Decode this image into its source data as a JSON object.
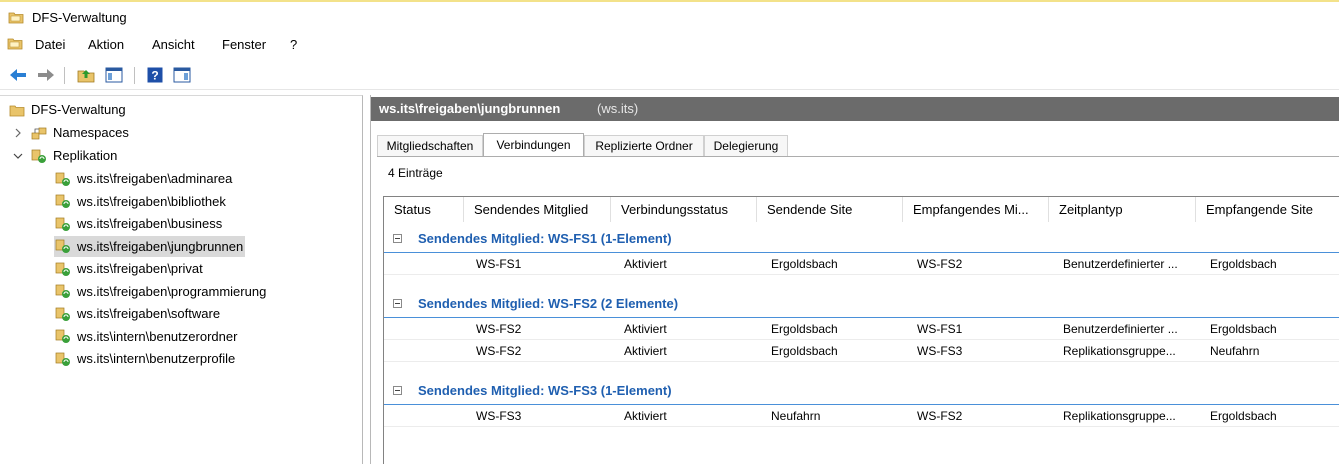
{
  "window": {
    "title": "DFS-Verwaltung"
  },
  "menu": {
    "items": [
      "Datei",
      "Aktion",
      "Ansicht",
      "Fenster",
      "?"
    ]
  },
  "toolbar": {
    "icons": [
      "back-arrow-icon",
      "forward-arrow-icon",
      "up-folder-icon",
      "show-hide-tree-icon",
      "help-icon",
      "action-pane-icon"
    ]
  },
  "tree": {
    "root": "DFS-Verwaltung",
    "namespaces": "Namespaces",
    "replication": "Replikation",
    "groups": [
      "ws.its\\freigaben\\adminarea",
      "ws.its\\freigaben\\bibliothek",
      "ws.its\\freigaben\\business",
      "ws.its\\freigaben\\jungbrunnen",
      "ws.its\\freigaben\\privat",
      "ws.its\\freigaben\\programmierung",
      "ws.its\\freigaben\\software",
      "ws.its\\intern\\benutzerordner",
      "ws.its\\intern\\benutzerprofile"
    ],
    "selected_index": 3
  },
  "details": {
    "title": "ws.its\\freigaben\\jungbrunnen",
    "subtitle": "(ws.its)",
    "tabs": [
      "Mitgliedschaften",
      "Verbindungen",
      "Replizierte Ordner",
      "Delegierung"
    ],
    "active_tab": 1,
    "count": "4 Einträge",
    "columns": [
      "Status",
      "Sendendes Mitglied",
      "Verbindungsstatus",
      "Sendende Site",
      "Empfangendes Mi...",
      "Zeitplantyp",
      "Empfangende Site"
    ],
    "groups": [
      {
        "label": "Sendendes Mitglied: WS-FS1 (1-Element)",
        "rows": [
          [
            "WS-FS1",
            "Aktiviert",
            "Ergoldsbach",
            "WS-FS2",
            "Benutzerdefinierter ...",
            "Ergoldsbach"
          ]
        ]
      },
      {
        "label": "Sendendes Mitglied: WS-FS2 (2 Elemente)",
        "rows": [
          [
            "WS-FS2",
            "Aktiviert",
            "Ergoldsbach",
            "WS-FS1",
            "Benutzerdefinierter ...",
            "Ergoldsbach"
          ],
          [
            "WS-FS2",
            "Aktiviert",
            "Ergoldsbach",
            "WS-FS3",
            "Replikationsgruppe...",
            "Neufahrn"
          ]
        ]
      },
      {
        "label": "Sendendes Mitglied: WS-FS3 (1-Element)",
        "rows": [
          [
            "WS-FS3",
            "Aktiviert",
            "Neufahrn",
            "WS-FS2",
            "Replikationsgruppe...",
            "Ergoldsbach"
          ]
        ]
      }
    ]
  },
  "colors": {
    "accent_group_text": "#1f5fb0",
    "header_bar": "#6b6b6b",
    "selection": "#d9d9d9"
  }
}
